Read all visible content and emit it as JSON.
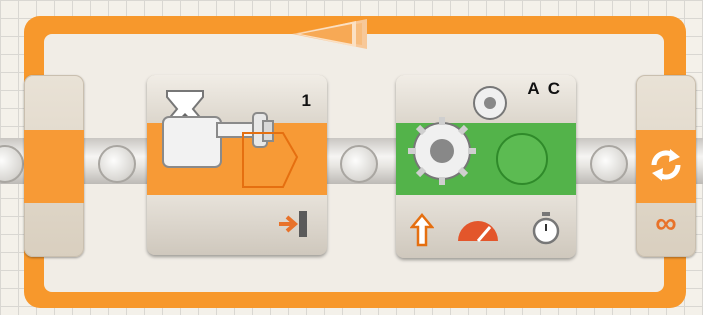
{
  "canvas": {
    "background": "#f4f1ea",
    "grid_color": "#d9d7d2"
  },
  "loop": {
    "color": "#f7982c",
    "count_symbol": "∞",
    "arrow_direction": "left",
    "icon": "loop-repeat-icon"
  },
  "wait_block": {
    "port_number": "1",
    "icon": "hourglass-wait-icon",
    "sensor_icon": "touch-sensor-icon",
    "action_icon": "pressed-bumped-icon",
    "mid_color": "#f79a36"
  },
  "move_block": {
    "ports": "A C",
    "icon": "gears-move-icon",
    "mid_color": "#53b34a",
    "direction_icon": "arrow-up-icon",
    "power_icon": "power-gauge-icon",
    "duration_icon": "stopwatch-icon"
  }
}
